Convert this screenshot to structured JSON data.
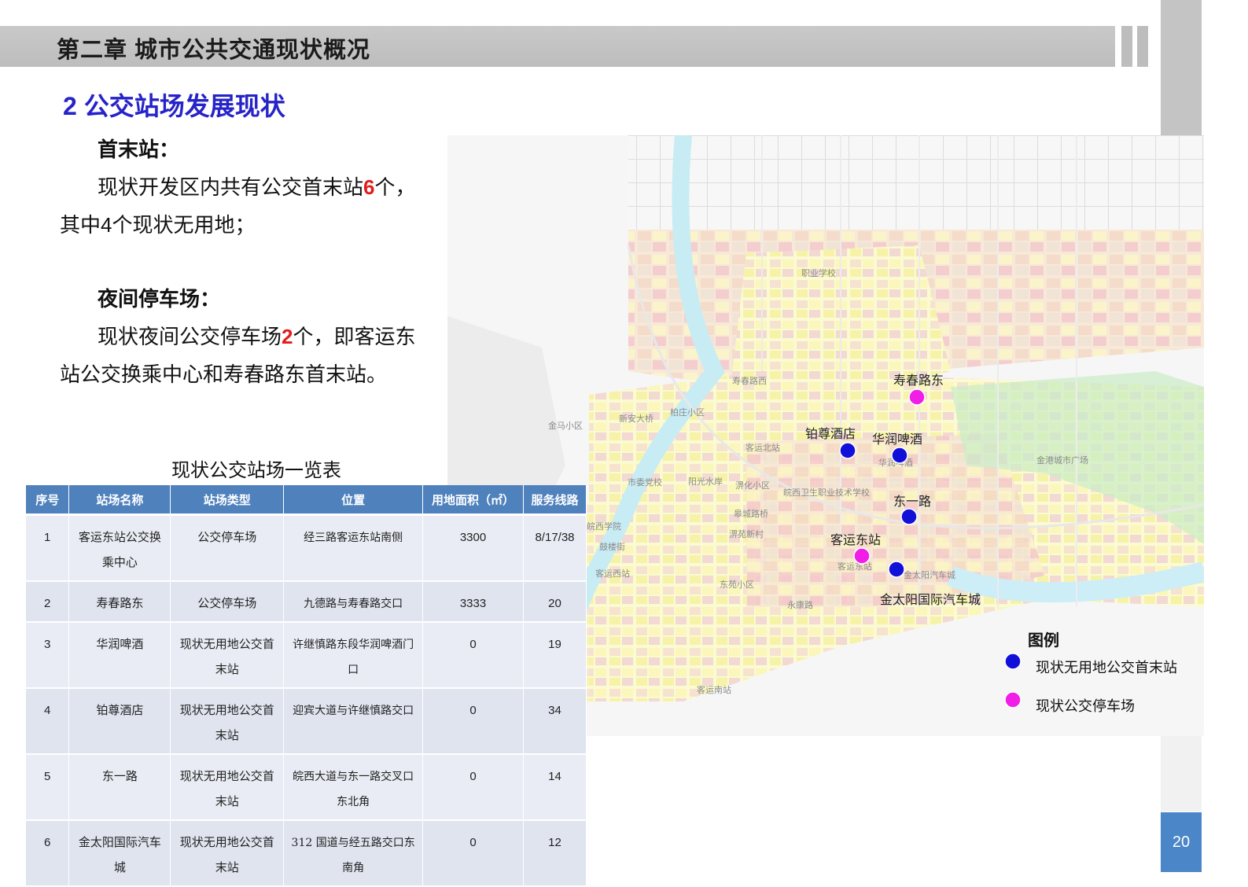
{
  "header": {
    "title": "第二章 城市公共交通现状概况"
  },
  "section": {
    "title": "2 公交站场发展现状"
  },
  "terminal": {
    "heading": "首末站：",
    "line1_a": "现状开发区内共有公交首末站",
    "line1_num": "6",
    "line1_b": "个，",
    "line2": "其中4个现状无用地；"
  },
  "depot": {
    "heading": "夜间停车场：",
    "line1_a": "现状夜间公交停车场",
    "line1_num": "2",
    "line1_b": "个，即客运东",
    "line2": "站公交换乘中心和寿春路东首末站。"
  },
  "table": {
    "caption": "现状公交站场一览表",
    "headers": [
      "序号",
      "站场名称",
      "站场类型",
      "位置",
      "用地面积（㎡）",
      "服务线路"
    ],
    "rows": [
      [
        "1",
        "客运东站公交换乘中心",
        "公交停车场",
        "经三路客运东站南侧",
        "3300",
        "8/17/38"
      ],
      [
        "2",
        "寿春路东",
        "公交停车场",
        "九德路与寿春路交口",
        "3333",
        "20"
      ],
      [
        "3",
        "华润啤酒",
        "现状无用地公交首末站",
        "许继慎路东段华润啤酒门口",
        "0",
        "19"
      ],
      [
        "4",
        "铂尊酒店",
        "现状无用地公交首末站",
        "迎宾大道与许继慎路交口",
        "0",
        "34"
      ],
      [
        "5",
        "东一路",
        "现状无用地公交首末站",
        "皖西大道与东一路交叉口东北角",
        "0",
        "14"
      ],
      [
        "6",
        "金太阳国际汽车城",
        "现状无用地公交首末站",
        "312 国道与经五路交口东南角",
        "0",
        "12"
      ]
    ]
  },
  "map": {
    "stations": [
      {
        "name": "寿春路东",
        "type": "depot"
      },
      {
        "name": "铂尊酒店",
        "type": "terminal"
      },
      {
        "name": "华润啤酒",
        "type": "terminal"
      },
      {
        "name": "东一路",
        "type": "terminal"
      },
      {
        "name": "客运东站",
        "type": "depot"
      },
      {
        "name": "金太阳国际汽车城",
        "type": "terminal"
      }
    ],
    "minor_labels": [
      "职业学校",
      "寿春路西",
      "柏庄小区",
      "新安大桥",
      "金马小区",
      "客运北站",
      "金港城市广场",
      "市委党校",
      "阳光水岸",
      "淠化小区",
      "皖西卫生职业技术学校",
      "皋城路桥",
      "皖西学院",
      "淠苑新村",
      "鼓楼街",
      "客运西站",
      "东苑小区",
      "永康路",
      "客运南站",
      "华润啤酒",
      "客运东站",
      "金太阳汽车城"
    ],
    "legend": {
      "title": "图例",
      "terminal": "现状无用地公交首末站",
      "depot": "现状公交停车场",
      "terminal_color": "#1010d8",
      "depot_color": "#f01ee6"
    }
  },
  "page": {
    "number": "20"
  }
}
